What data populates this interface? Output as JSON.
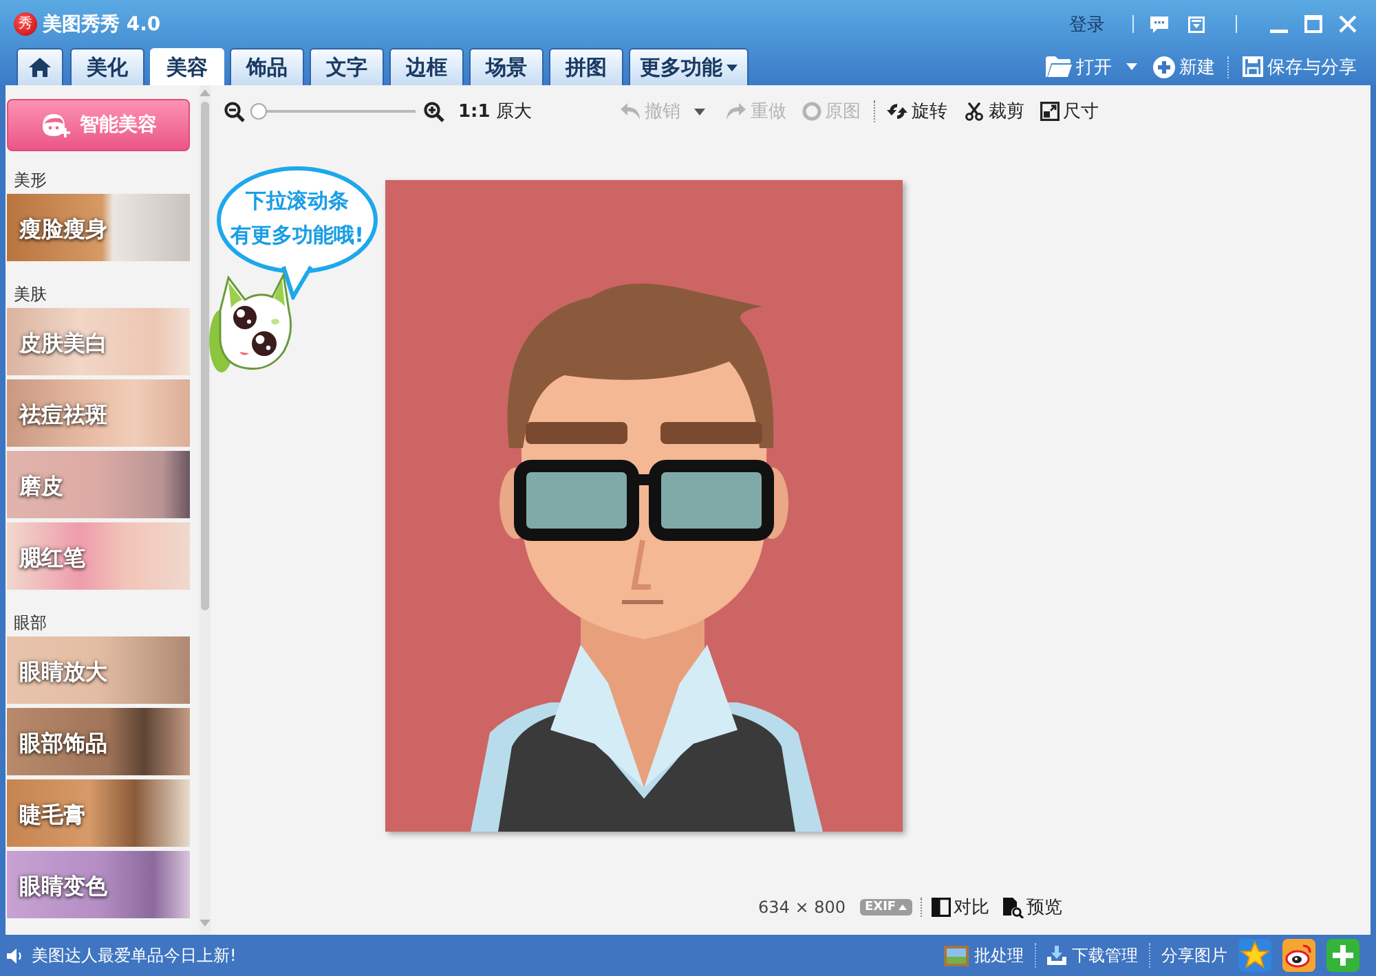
{
  "window": {
    "logo": "秀",
    "title": "美图秀秀 4.0",
    "login": "登录",
    "tools": [
      {
        "kind": "feedback"
      },
      {
        "kind": "skin"
      }
    ],
    "controls": [
      {
        "kind": "minimize"
      },
      {
        "kind": "maximize"
      },
      {
        "kind": "close"
      }
    ]
  },
  "tabs": [
    {
      "kind": "home",
      "selected": false
    },
    {
      "kind": "text",
      "label": "美化",
      "selected": false
    },
    {
      "kind": "text",
      "label": "美容",
      "selected": true
    },
    {
      "kind": "text",
      "label": "饰品",
      "selected": false
    },
    {
      "kind": "text",
      "label": "文字",
      "selected": false
    },
    {
      "kind": "text",
      "label": "边框",
      "selected": false
    },
    {
      "kind": "text",
      "label": "场景",
      "selected": false
    },
    {
      "kind": "text",
      "label": "拼图",
      "selected": false
    },
    {
      "kind": "menu",
      "label": "更多功能",
      "selected": false
    }
  ],
  "file_actions": [
    {
      "kind": "open",
      "label": "打开",
      "dropdown": true
    },
    {
      "kind": "new",
      "label": "新建"
    },
    {
      "kind": "save",
      "label": "保存与分享"
    }
  ],
  "sidebar": {
    "smart_button": "智能美容",
    "sections": [
      {
        "title": "美形",
        "items": [
          "瘦脸瘦身"
        ]
      },
      {
        "title": "美肤",
        "items": [
          "皮肤美白",
          "祛痘祛斑",
          "磨皮",
          "腮红笔"
        ]
      },
      {
        "title": "眼部",
        "items": [
          "眼睛放大",
          "眼部饰品",
          "睫毛膏",
          "眼睛变色"
        ]
      }
    ]
  },
  "toolbar": {
    "zoom": {
      "level": 0
    },
    "actual_size": "**1:1** 原大",
    "history": [
      {
        "kind": "undo",
        "label": "撤销",
        "disabled": true,
        "dropdown": true
      },
      {
        "kind": "redo",
        "label": "重做",
        "disabled": true
      },
      {
        "kind": "original",
        "label": "原图",
        "disabled": true
      }
    ],
    "edit": [
      {
        "kind": "rotate",
        "label": "旋转",
        "disabled": false
      },
      {
        "kind": "crop",
        "label": "裁剪",
        "disabled": false
      },
      {
        "kind": "resize",
        "label": "尺寸",
        "disabled": false
      }
    ]
  },
  "hint": {
    "lines": [
      "下拉滚动条",
      "有更多功能哦!"
    ]
  },
  "image": {
    "size": "634 × 800",
    "exif": "EXIF"
  },
  "view_actions": [
    {
      "kind": "compare",
      "label": "对比"
    },
    {
      "kind": "preview",
      "label": "预览"
    }
  ],
  "status_bar": {
    "message": "美图达人最爱单品今日上新!",
    "actions": [
      {
        "kind": "batch",
        "label": "批处理"
      },
      {
        "kind": "download",
        "label": "下载管理"
      },
      {
        "kind": "share",
        "label": "分享图片"
      }
    ],
    "share_icons": [
      {
        "kind": "qzone"
      },
      {
        "kind": "weibo"
      },
      {
        "kind": "add"
      }
    ]
  }
}
